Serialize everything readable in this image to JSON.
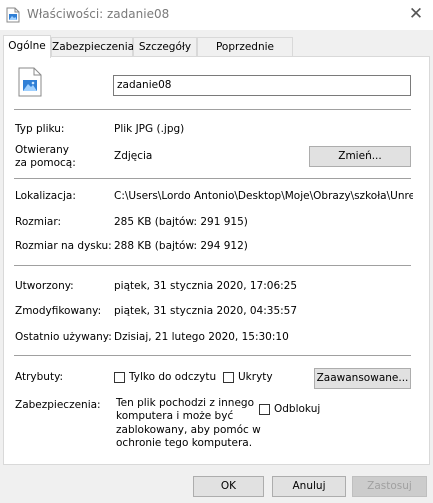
{
  "window": {
    "title": "Właściwości: zadanie08",
    "close_glyph": "✕"
  },
  "tabs": [
    {
      "label": "Ogólne",
      "active": true
    },
    {
      "label": "Zabezpieczenia"
    },
    {
      "label": "Szczegóły"
    },
    {
      "label": "Poprzednie wersje"
    }
  ],
  "file": {
    "name": "zadanie08",
    "icon": "image-file-icon"
  },
  "general": {
    "type_label": "Typ pliku:",
    "type_value": "Plik JPG (.jpg)",
    "opens_with_label_1": "Otwierany",
    "opens_with_label_2": "za pomocą:",
    "opens_with_value": "Zdjęcia",
    "change_button": "Zmień...",
    "location_label": "Lokalizacja:",
    "location_value": "C:\\Users\\Lordo Antonio\\Desktop\\Moje\\Obrazy\\szkoła\\Unreall",
    "size_label": "Rozmiar:",
    "size_value": "285 KB (bajtów: 291 915)",
    "disk_size_label": "Rozmiar na dysku:",
    "disk_size_value": "288 KB (bajtów: 294 912)",
    "created_label": "Utworzony:",
    "created_value": "piątek, 31 stycznia 2020, 17:06:25",
    "modified_label": "Zmodyfikowany:",
    "modified_value": "piątek, 31 stycznia 2020, 04:35:57",
    "accessed_label": "Ostatnio używany:",
    "accessed_value": "Dzisiaj, 21 lutego 2020, 15:30:10",
    "attributes_label": "Atrybuty:",
    "readonly_label": "Tylko do odczytu",
    "hidden_label": "Ukryty",
    "advanced_button": "Zaawansowane...",
    "security_label": "Zabezpieczenia:",
    "security_text_1": "Ten plik pochodzi z innego",
    "security_text_2": "komputera i może być",
    "security_text_3": "zablokowany, aby pomóc w",
    "security_text_4": "ochronie tego komputera.",
    "unblock_label": "Odblokuj"
  },
  "buttons": {
    "ok": "OK",
    "cancel": "Anuluj",
    "apply": "Zastosuj"
  },
  "colors": {
    "title_text": "#7a7a7a",
    "window_bg": "#f0f0f0",
    "panel_bg": "#ffffff",
    "disabled_text": "#a0a0a0"
  }
}
